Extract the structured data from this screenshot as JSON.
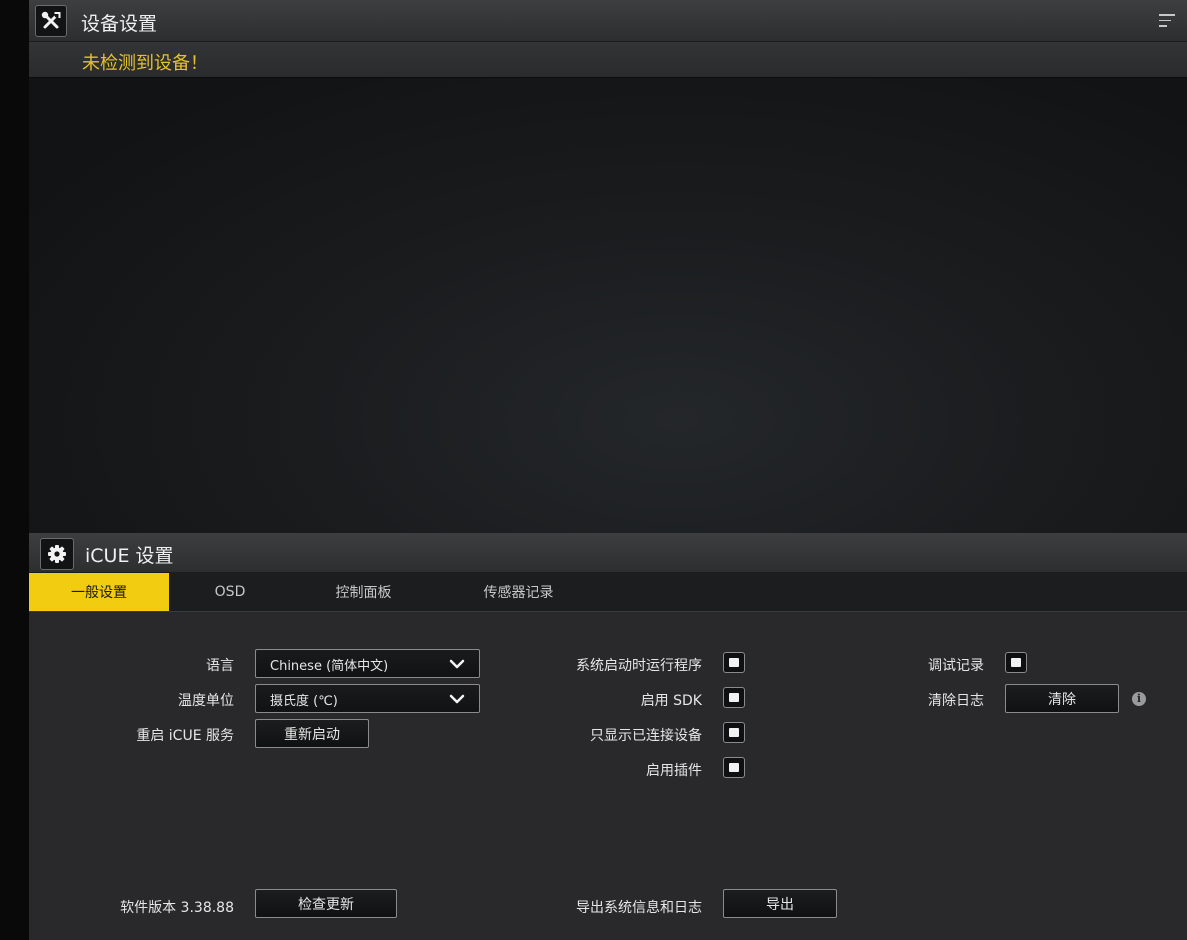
{
  "device_panel": {
    "title": "设备设置",
    "status": "未检测到设备！",
    "header_icon": "tools-icon",
    "menu_icon": "menu-icon"
  },
  "icue_panel": {
    "title": "iCUE 设置",
    "header_icon": "gear-icon"
  },
  "tabs": [
    {
      "label": "一般设置",
      "active": true
    },
    {
      "label": "OSD",
      "active": false
    },
    {
      "label": "控制面板",
      "active": false
    },
    {
      "label": "传感器记录",
      "active": false
    }
  ],
  "general": {
    "language_label": "语言",
    "language_value": "Chinese (简体中文)",
    "temp_unit_label": "温度单位",
    "temp_unit_value": "摄氏度 (℃)",
    "restart_service_label": "重启 iCUE 服务",
    "restart_button": "重新启动",
    "autostart_label": "系统启动时运行程序",
    "autostart_checked": true,
    "enable_sdk_label": "启用 SDK",
    "enable_sdk_checked": true,
    "connected_only_label": "只显示已连接设备",
    "connected_only_checked": true,
    "enable_plugins_label": "启用插件",
    "enable_plugins_checked": true,
    "debug_log_label": "调试记录",
    "debug_log_checked": true,
    "clear_log_label": "清除日志",
    "clear_button": "清除",
    "info_icon": "info-icon",
    "version_label": "软件版本 3.38.88",
    "check_update_button": "检查更新",
    "export_label": "导出系统信息和日志",
    "export_button": "导出"
  },
  "colors": {
    "accent": "#f2cc11",
    "warning_text": "#e5c12c",
    "panel_bg": "#29292c"
  }
}
